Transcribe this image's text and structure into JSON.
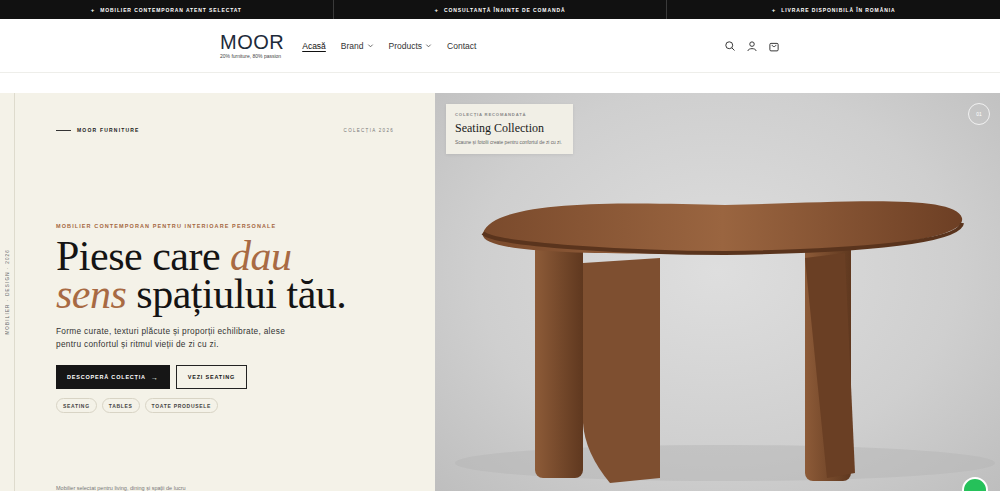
{
  "topbar": {
    "items": [
      {
        "icon": "+",
        "text": "MOBILIER CONTEMPORAN ATENT SELECTAT"
      },
      {
        "icon": "+",
        "text": "CONSULTANȚĂ ÎNAINTE DE COMANDĂ"
      },
      {
        "icon": "+",
        "text": "LIVRARE DISPONIBILĂ ÎN ROMÂNIA"
      }
    ]
  },
  "header": {
    "logo": {
      "name": "MOOR",
      "tagline": "20% furniture, 80% passion"
    },
    "nav": [
      {
        "label": "Acasă",
        "selected": true,
        "dropdown": false
      },
      {
        "label": "Brand",
        "selected": false,
        "dropdown": true
      },
      {
        "label": "Products",
        "selected": false,
        "dropdown": true
      },
      {
        "label": "Contact",
        "selected": false,
        "dropdown": false
      }
    ]
  },
  "hero": {
    "side_label": "MOBILIER · DESIGN · 2026",
    "brand": "MOOR FURNITURE",
    "collection": "COLECȚIA 2026",
    "eyebrow": "MOBILIER CONTEMPORAN PENTRU INTERIOARE PERSONALE",
    "headline": {
      "before": "Piese care ",
      "accent": "dau sens",
      "after": " spațiului tău."
    },
    "lead": "Forme curate, texturi plăcute și proporții echilibrate, alese pentru confortul și ritmul vieții de zi cu zi.",
    "buttons": [
      {
        "label": "DESCOPERĂ COLECȚIA",
        "arrow": "→",
        "kind": "primary"
      },
      {
        "label": "VEZI SEATING",
        "arrow": "",
        "kind": "secondary"
      }
    ],
    "chips": [
      "SEATING",
      "TABLES",
      "TOATE PRODUSELE"
    ],
    "footnote": "Mobilier selectat pentru living, dining și spații de lucru"
  },
  "feature": {
    "eyebrow": "COLECȚIA RECOMANDATĂ",
    "title": "Seating Collection",
    "text": "Scaune și fotolii create pentru confortul de zi cu zi.",
    "slide": "01"
  }
}
